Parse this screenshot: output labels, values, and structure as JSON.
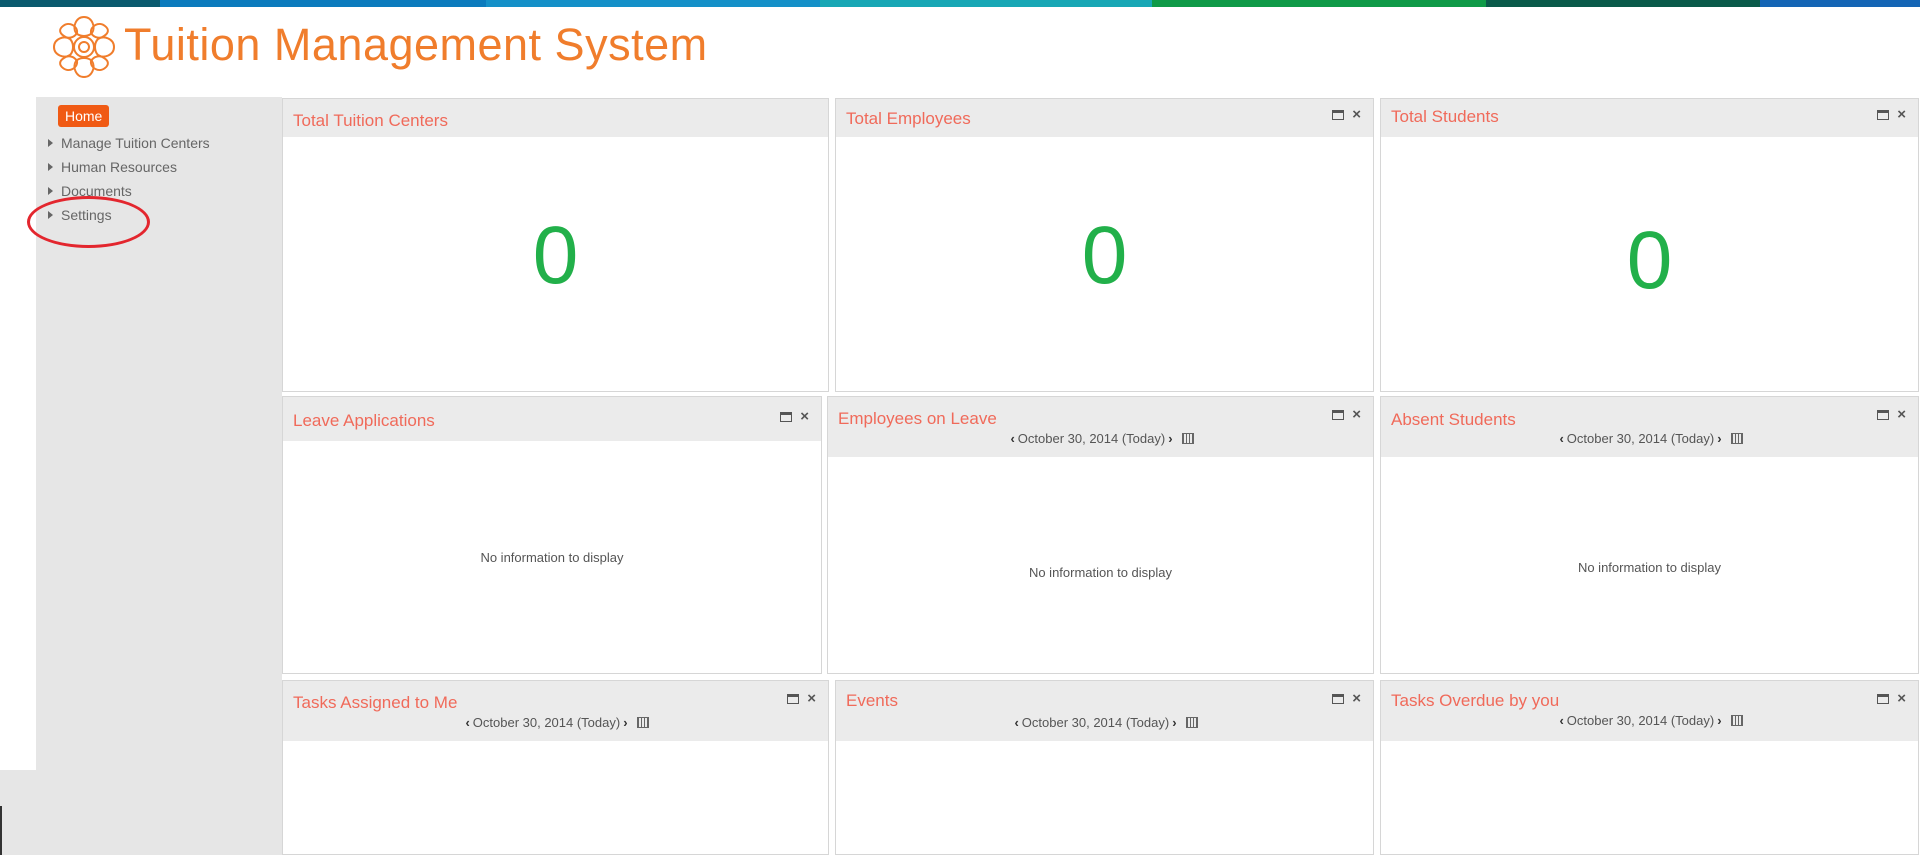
{
  "header": {
    "title": "Tuition Management System",
    "logo_icon": "flower-logo-icon",
    "accent": "#f07d2c"
  },
  "topbar_colors": [
    "#0a5a6e",
    "#0b7bbd",
    "#1490c8",
    "#18a7b5",
    "#0f9a48",
    "#0a5a4a",
    "#1465b5"
  ],
  "sidebar": {
    "home_label": "Home",
    "items": [
      {
        "label": "Manage Tuition Centers"
      },
      {
        "label": "Human Resources"
      },
      {
        "label": "Documents"
      },
      {
        "label": "Settings"
      }
    ]
  },
  "widgets": {
    "total_tuition_centers": {
      "title": "Total Tuition Centers",
      "value": "0"
    },
    "total_employees": {
      "title": "Total Employees",
      "value": "0"
    },
    "total_students": {
      "title": "Total Students",
      "value": "0"
    },
    "leave_applications": {
      "title": "Leave Applications",
      "empty": "No information to display"
    },
    "employees_on_leave": {
      "title": "Employees on Leave",
      "date": "October 30, 2014 (Today)",
      "empty": "No information to display"
    },
    "absent_students": {
      "title": "Absent Students",
      "date": "October 30, 2014 (Today)",
      "empty": "No information to display"
    },
    "tasks_assigned": {
      "title": "Tasks Assigned to Me",
      "date": "October 30, 2014 (Today)"
    },
    "events": {
      "title": "Events",
      "date": "October 30, 2014 (Today)"
    },
    "tasks_overdue": {
      "title": "Tasks Overdue by you",
      "date": "October 30, 2014 (Today)"
    }
  },
  "colors": {
    "number_green": "#22b04a",
    "title_red": "#f06a5a",
    "home_orange": "#f05a14",
    "annotation_red": "#e3262e"
  }
}
